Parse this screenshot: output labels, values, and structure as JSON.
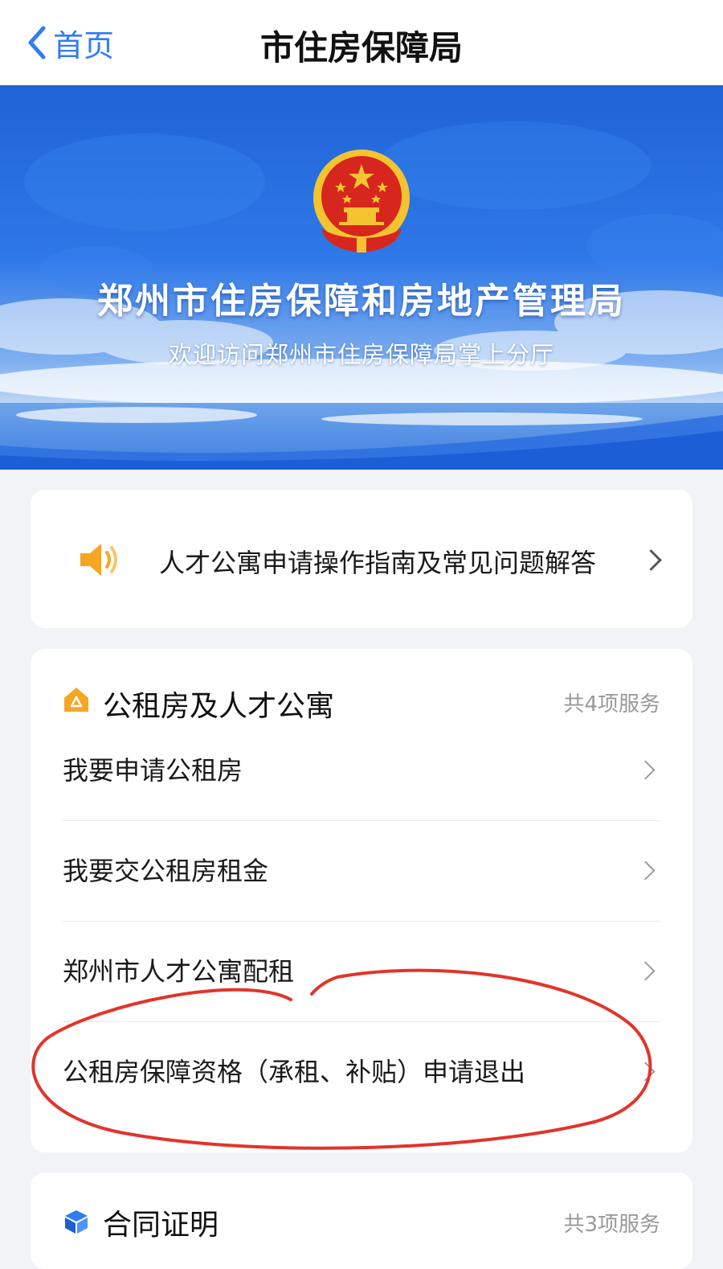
{
  "navbar": {
    "back_label": "首页",
    "title": "市住房保障局"
  },
  "banner": {
    "title": "郑州市住房保障和房地产管理局",
    "subtitle": "欢迎访问郑州市住房保障局掌上分厅"
  },
  "notice": {
    "icon": "speaker-icon",
    "text": "人才公寓申请操作指南及常见问题解答"
  },
  "services": {
    "icon": "house-icon",
    "title": "公租房及人才公寓",
    "count": "共4项服务",
    "items": [
      {
        "label": "我要申请公租房"
      },
      {
        "label": "我要交公租房租金"
      },
      {
        "label": "郑州市人才公寓配租"
      },
      {
        "label": "公租房保障资格（承租、补贴）申请退出"
      }
    ]
  },
  "next_section": {
    "icon": "cube-icon",
    "title": "合同证明",
    "count": "共3项服务"
  },
  "colors": {
    "accent": "#2f7cf6",
    "annotation": "#e2342b",
    "icon_orange": "#f5a623"
  }
}
